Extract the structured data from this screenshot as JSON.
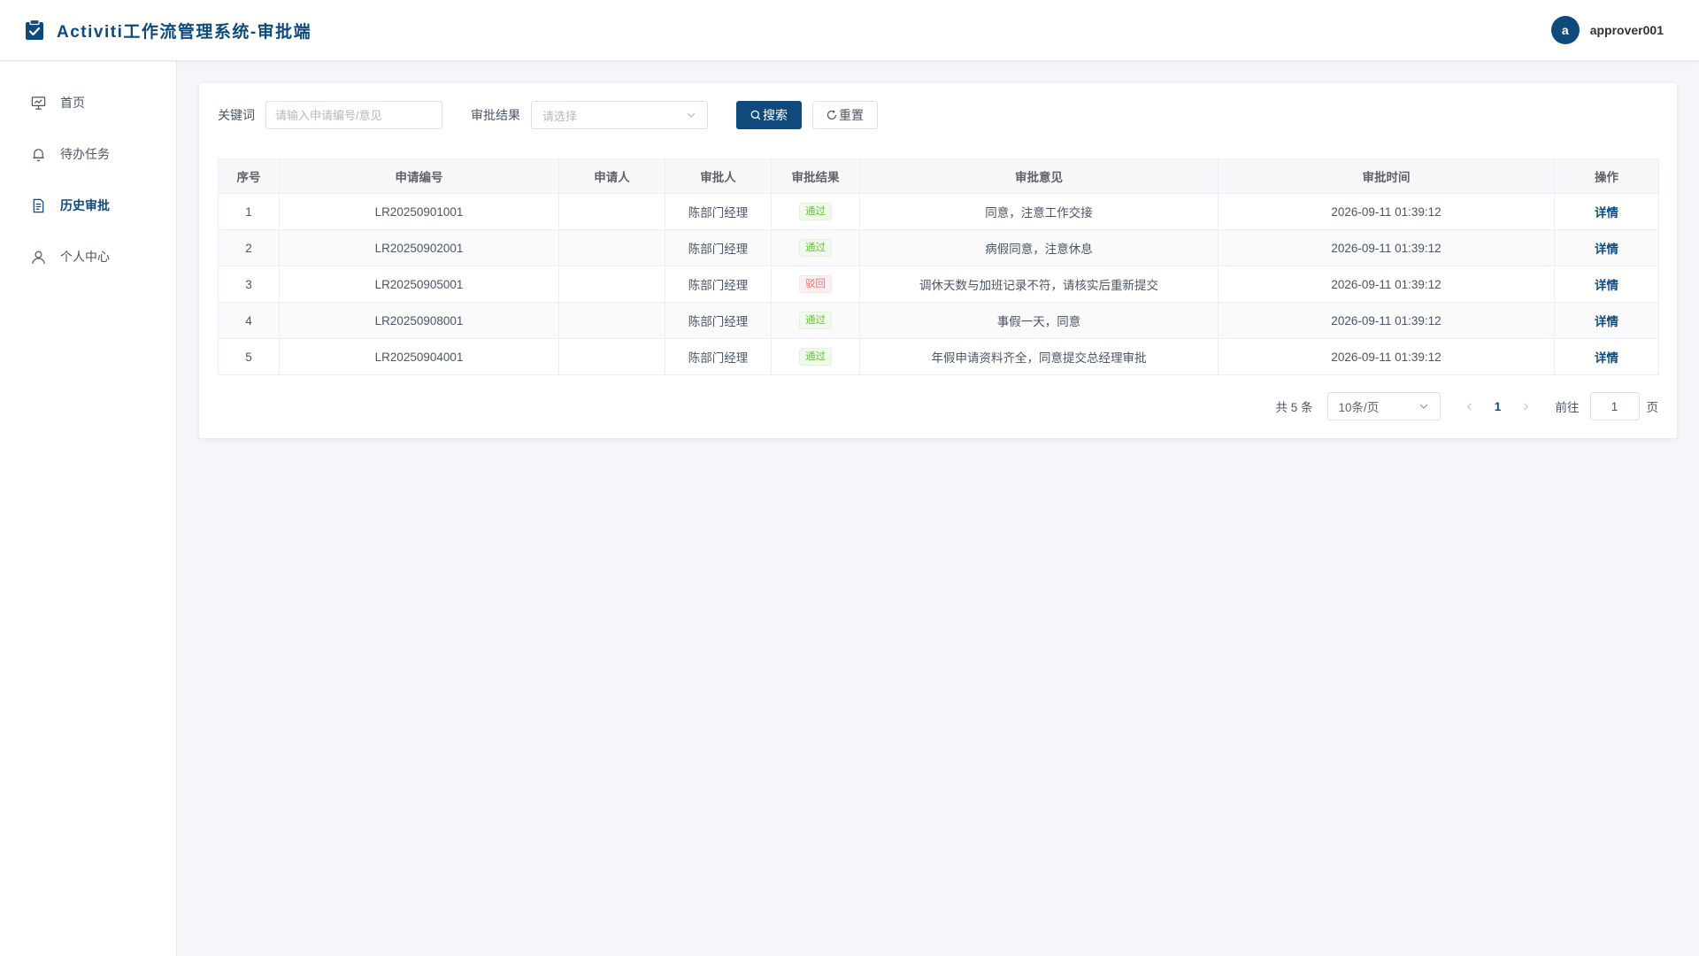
{
  "header": {
    "title": "Activiti工作流管理系统-审批端",
    "brand_icon": "clipboard-check-icon",
    "user": {
      "avatar_letter": "a",
      "username": "approver001"
    }
  },
  "colors": {
    "primary": "#0f4a7d",
    "success": "#67c23a",
    "danger": "#f56c6c"
  },
  "sidebar": {
    "items": [
      {
        "label": "首页",
        "icon": "dashboard-icon",
        "active": false
      },
      {
        "label": "待办任务",
        "icon": "bell-icon",
        "active": false
      },
      {
        "label": "历史审批",
        "icon": "document-icon",
        "active": true
      },
      {
        "label": "个人中心",
        "icon": "user-icon",
        "active": false
      }
    ]
  },
  "filters": {
    "keyword_label": "关键词",
    "keyword_placeholder": "请输入申请编号/意见",
    "keyword_value": "",
    "result_label": "审批结果",
    "result_placeholder": "请选择",
    "search_label": "搜索",
    "reset_label": "重置"
  },
  "table": {
    "columns": [
      "序号",
      "申请编号",
      "申请人",
      "审批人",
      "审批结果",
      "审批意见",
      "审批时间",
      "操作"
    ],
    "rows": [
      {
        "index": "1",
        "app_no": "LR20250901001",
        "applicant": "",
        "approver": "陈部门经理",
        "result": "通过",
        "result_type": "pass",
        "opinion": "同意，注意工作交接",
        "time": "2026-09-11 01:39:12",
        "action": "详情"
      },
      {
        "index": "2",
        "app_no": "LR20250902001",
        "applicant": "",
        "approver": "陈部门经理",
        "result": "通过",
        "result_type": "pass",
        "opinion": "病假同意，注意休息",
        "time": "2026-09-11 01:39:12",
        "action": "详情"
      },
      {
        "index": "3",
        "app_no": "LR20250905001",
        "applicant": "",
        "approver": "陈部门经理",
        "result": "驳回",
        "result_type": "reject",
        "opinion": "调休天数与加班记录不符，请核实后重新提交",
        "time": "2026-09-11 01:39:12",
        "action": "详情"
      },
      {
        "index": "4",
        "app_no": "LR20250908001",
        "applicant": "",
        "approver": "陈部门经理",
        "result": "通过",
        "result_type": "pass",
        "opinion": "事假一天，同意",
        "time": "2026-09-11 01:39:12",
        "action": "详情"
      },
      {
        "index": "5",
        "app_no": "LR20250904001",
        "applicant": "",
        "approver": "陈部门经理",
        "result": "通过",
        "result_type": "pass",
        "opinion": "年假申请资料齐全，同意提交总经理审批",
        "time": "2026-09-11 01:39:12",
        "action": "详情"
      }
    ]
  },
  "pagination": {
    "total_text": "共 5 条",
    "page_size": "10条/页",
    "current_page": "1",
    "goto_label": "前往",
    "goto_value": "1",
    "page_suffix": "页"
  }
}
